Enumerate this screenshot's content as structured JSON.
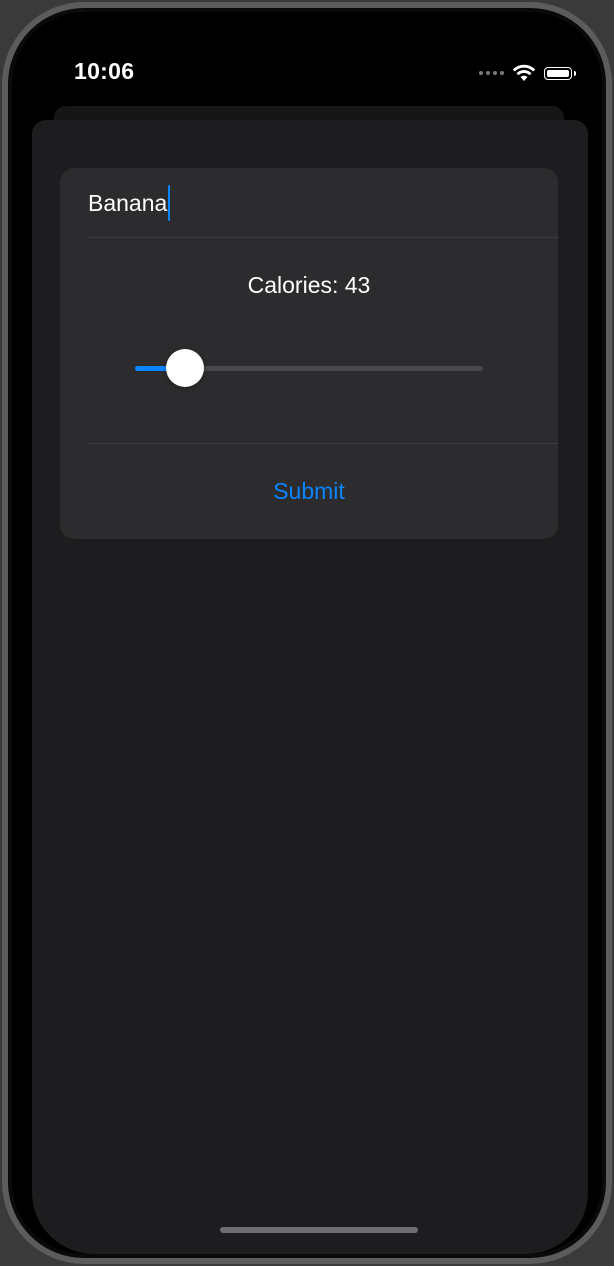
{
  "status_bar": {
    "time": "10:06",
    "icons": [
      "signal-dots-icon",
      "wifi-icon",
      "battery-icon"
    ]
  },
  "form": {
    "name_value": "Banana",
    "calories_label": "Calories: 43",
    "slider": {
      "value": 43,
      "fraction": 0.09
    },
    "submit_label": "Submit"
  },
  "colors": {
    "accent": "#0a84ff",
    "background": "#1d1d1f",
    "card": "#2c2c2e"
  }
}
